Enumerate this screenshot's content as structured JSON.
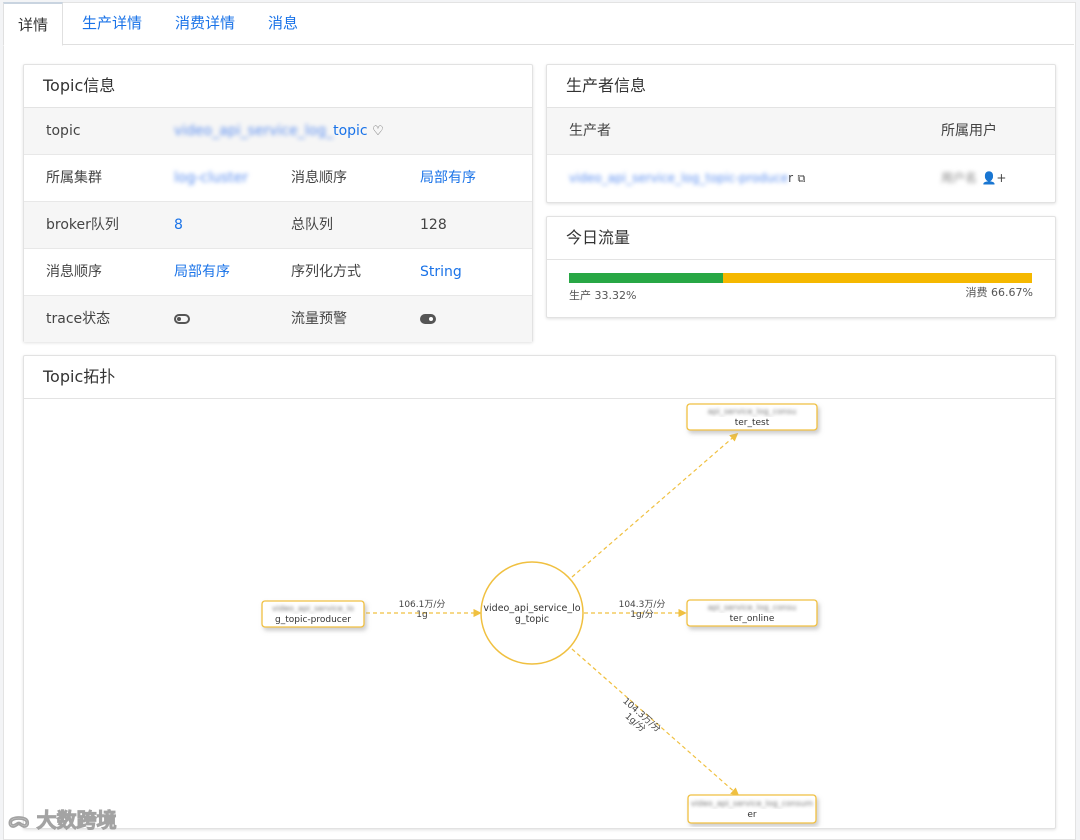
{
  "tabs": [
    {
      "label": "详情"
    },
    {
      "label": "生产详情"
    },
    {
      "label": "消费详情"
    },
    {
      "label": "消息"
    }
  ],
  "topic_info": {
    "title": "Topic信息",
    "rows": {
      "topic": {
        "label": "topic",
        "value_blur": "video_api_service_log_",
        "value": "topic"
      },
      "cluster": {
        "label": "所属集群",
        "value": "log-cluster",
        "label2": "消息顺序",
        "value2": "局部有序"
      },
      "broker": {
        "label": "broker队列",
        "value": "8",
        "label2": "总队列",
        "value2": "128"
      },
      "order": {
        "label": "消息顺序",
        "value": "局部有序",
        "label2": "序列化方式",
        "value2": "String"
      },
      "trace": {
        "label": "trace状态",
        "label2": "流量预警"
      }
    }
  },
  "producer_info": {
    "title": "生产者信息",
    "col_producer": "生产者",
    "col_user": "所属用户",
    "producer_blur": "video_api_service_log_topic-produce",
    "producer_suffix": "r",
    "user": "用户名"
  },
  "traffic": {
    "title": "今日流量",
    "produce_label": "生产 33.32%",
    "consume_label": "消费 66.67%",
    "produce_percent": 33.32,
    "consume_percent": 66.67,
    "produce_color": "#28a745",
    "consume_color": "#f5b800"
  },
  "topology": {
    "title": "Topic拓扑",
    "center_line1": "video_api_service_lo",
    "center_line2": "g_topic",
    "producer_blur": "video_api_service_lo",
    "producer_line2": "g_topic-producer",
    "consumer_test_blur": "api_service_log_consu",
    "consumer_test_line2": "ter_test",
    "consumer_online_blur": "api_service_log_consu",
    "consumer_online_line2": "ter_online",
    "consumer3_blur": "video_api_service_log_consum",
    "consumer3_line2": "er",
    "edge_in_1": "106.1万/分",
    "edge_in_2": "1g",
    "edge_online_1": "104.3万/分",
    "edge_online_2": "1g/分",
    "edge_down_1": "104.3万/分",
    "edge_down_2": "1g/分",
    "node_color": "#f0c040"
  },
  "watermark": "大数跨境"
}
